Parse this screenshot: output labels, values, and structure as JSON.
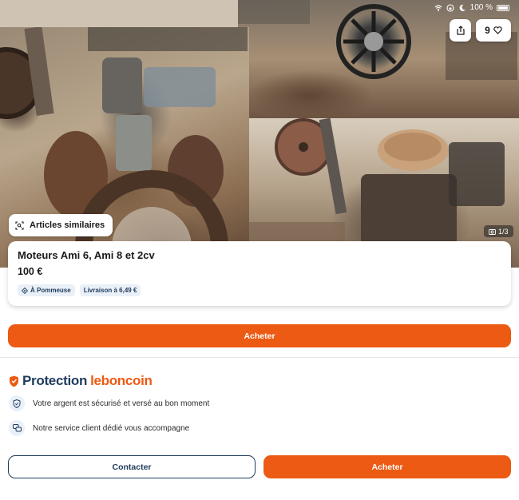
{
  "status_bar": {
    "battery_text": "100 %"
  },
  "gallery": {
    "photo_count": "1/3",
    "favorites_count": "9",
    "similar_label": "Articles similaires"
  },
  "listing": {
    "title": "Moteurs Ami 6, Ami 8 et 2cv",
    "price": "100 €",
    "location_tag": "À Pommeuse",
    "delivery_tag": "Livraison à 6,49 €"
  },
  "actions": {
    "buy_label": "Acheter",
    "contact_label": "Contacter"
  },
  "protection": {
    "title_word": "Protection",
    "title_brand": "leboncoin",
    "rows": [
      {
        "icon": "shield-check-icon",
        "text": "Votre argent est sécurisé et versé au bon moment"
      },
      {
        "icon": "chat-bubbles-icon",
        "text": "Notre service client dédié vous accompagne"
      }
    ]
  },
  "colors": {
    "accent": "#ec5a13",
    "navy": "#1f3b5c",
    "tag_bg": "#eaf0f8"
  }
}
